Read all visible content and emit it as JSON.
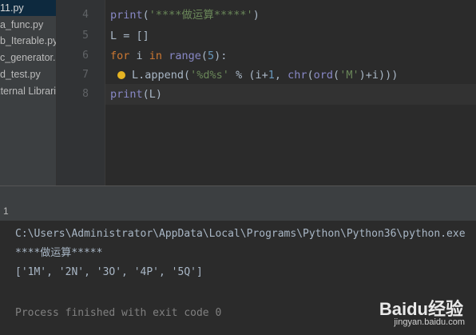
{
  "sidebar": {
    "items": [
      {
        "label": "11.py",
        "selected": true
      },
      {
        "label": "a_func.py",
        "selected": false
      },
      {
        "label": "b_Iterable.py",
        "selected": false
      },
      {
        "label": "c_generator.py",
        "selected": false
      },
      {
        "label": "d_test.py",
        "selected": false
      },
      {
        "label": "External Libraries",
        "selected": false
      }
    ]
  },
  "editor": {
    "lines": [
      {
        "num": "4",
        "code": "print('****做运算*****')"
      },
      {
        "num": "5",
        "code": "L = []"
      },
      {
        "num": "6",
        "code": "for i in range(5):"
      },
      {
        "num": "7",
        "code": "L.append('%d%s' % (i+1, chr(ord('M')+i)))"
      },
      {
        "num": "8",
        "code": "print(L)"
      }
    ],
    "bulb_icon": "lightbulb-icon"
  },
  "run_panel": {
    "tab_label": "1",
    "output": [
      "C:\\Users\\Administrator\\AppData\\Local\\Programs\\Python\\Python36\\python.exe",
      "****做运算*****",
      "['1M', '2N', '3O', '4P', '5Q']",
      "",
      "Process finished with exit code 0"
    ]
  },
  "watermark": {
    "logo": "Baidu经验",
    "url": "jingyan.baidu.com"
  }
}
